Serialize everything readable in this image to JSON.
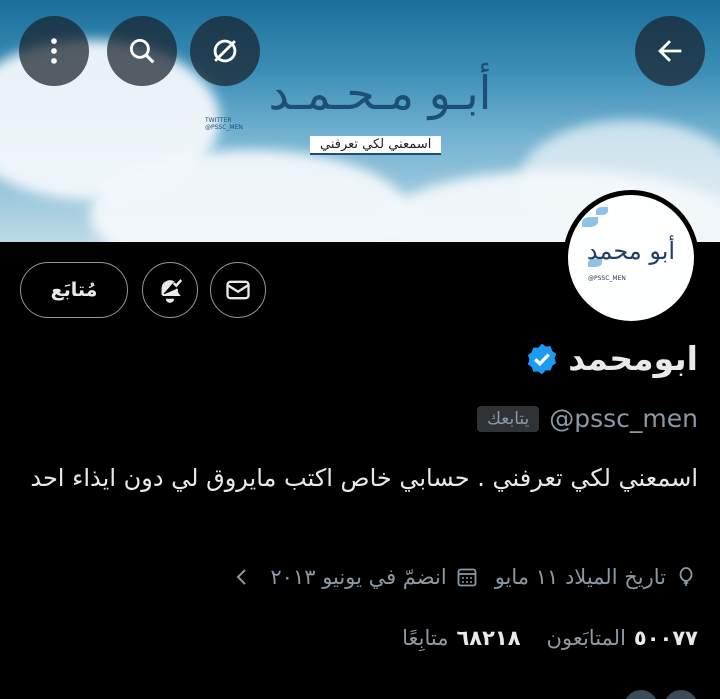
{
  "banner": {
    "title": "أبـو مـحـمـد",
    "twitter_label": "TWITTER",
    "twitter_handle": "@PSSC_MEN",
    "tagline": "اسمعني لكي تعرفني"
  },
  "avatar": {
    "text": "أبو محمد",
    "handle": "@PSSC_MEN"
  },
  "actions": {
    "follow_label": "مُتابَع"
  },
  "profile": {
    "display_name": "ابومحمد",
    "handle": "@pssc_men",
    "follows_you": "يتابعك",
    "bio": "اسمعني لكي تعرفني .  حسابي خاص اكتب  مايروق لي دون ايذاء احد",
    "birthday": "تاريخ الميلاد ١١ مايو",
    "joined": "انضمّ في يونيو ٢٠١٣",
    "following_count": "٥٠٠٧٧",
    "following_label": "المتابَعون",
    "followers_count": "٦٨٢١٨",
    "followers_label": "متابِعًا"
  },
  "icons": {
    "back": "arrow-left-icon",
    "unlock": "no-lock-icon",
    "search": "search-icon",
    "more": "more-vertical-icon",
    "message": "envelope-icon",
    "notify": "bell-check-icon",
    "verified": "verified-badge-icon",
    "location": "balloon-icon",
    "calendar": "calendar-icon"
  },
  "colors": {
    "verified": "#1d9bf0",
    "muted": "#8b98a5",
    "text": "#e7e9ea"
  }
}
